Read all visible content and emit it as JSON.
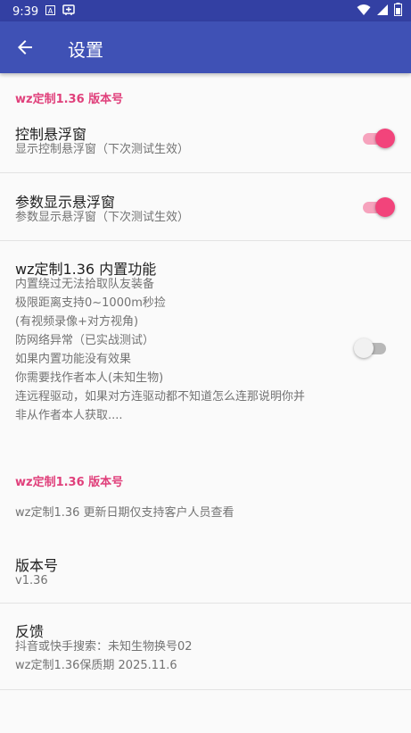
{
  "status_bar": {
    "time": "9:39",
    "left_icons": [
      "a-icon",
      "app-notification-icon"
    ],
    "right_icons": [
      "wifi-icon",
      "signal-icon",
      "battery-icon"
    ]
  },
  "app_bar": {
    "title": "设置"
  },
  "colors": {
    "app_bar": "#3f51b5",
    "status_bar": "#3340a3",
    "accent": "#f2447b",
    "category_text": "#e0407b"
  },
  "sections": [
    {
      "category": "wz定制1.36 版本号",
      "items": [
        {
          "title": "控制悬浮窗",
          "summary": "显示控制悬浮窗（下次测试生效）",
          "switch_on": true
        },
        {
          "title": "参数显示悬浮窗",
          "summary": "参数显示悬浮窗（下次测试生效）",
          "switch_on": true
        },
        {
          "title": "wz定制1.36 内置功能",
          "summary_lines": [
            "内置绕过无法拾取队友装备",
            "极限距离支持0~1000m秒捡",
            "(有视频录像+对方视角)",
            "防网络异常（已实战测试）",
            "如果内置功能没有效果",
            "你需要找作者本人(未知生物)",
            "连远程驱动，如果对方连驱动都不知道怎么连那说明你并",
            "非从作者本人获取...."
          ],
          "switch_on": false
        }
      ]
    },
    {
      "category": "wz定制1.36 版本号",
      "items": [
        {
          "summary": "wz定制1.36 更新日期仅支持客户人员查看"
        },
        {
          "title": "版本号",
          "summary": "v1.36"
        },
        {
          "title": "反馈",
          "summary_lines": [
            "抖音或快手搜索：未知生物换号02",
            "wz定制1.36保质期 2025.11.6"
          ]
        }
      ]
    }
  ]
}
